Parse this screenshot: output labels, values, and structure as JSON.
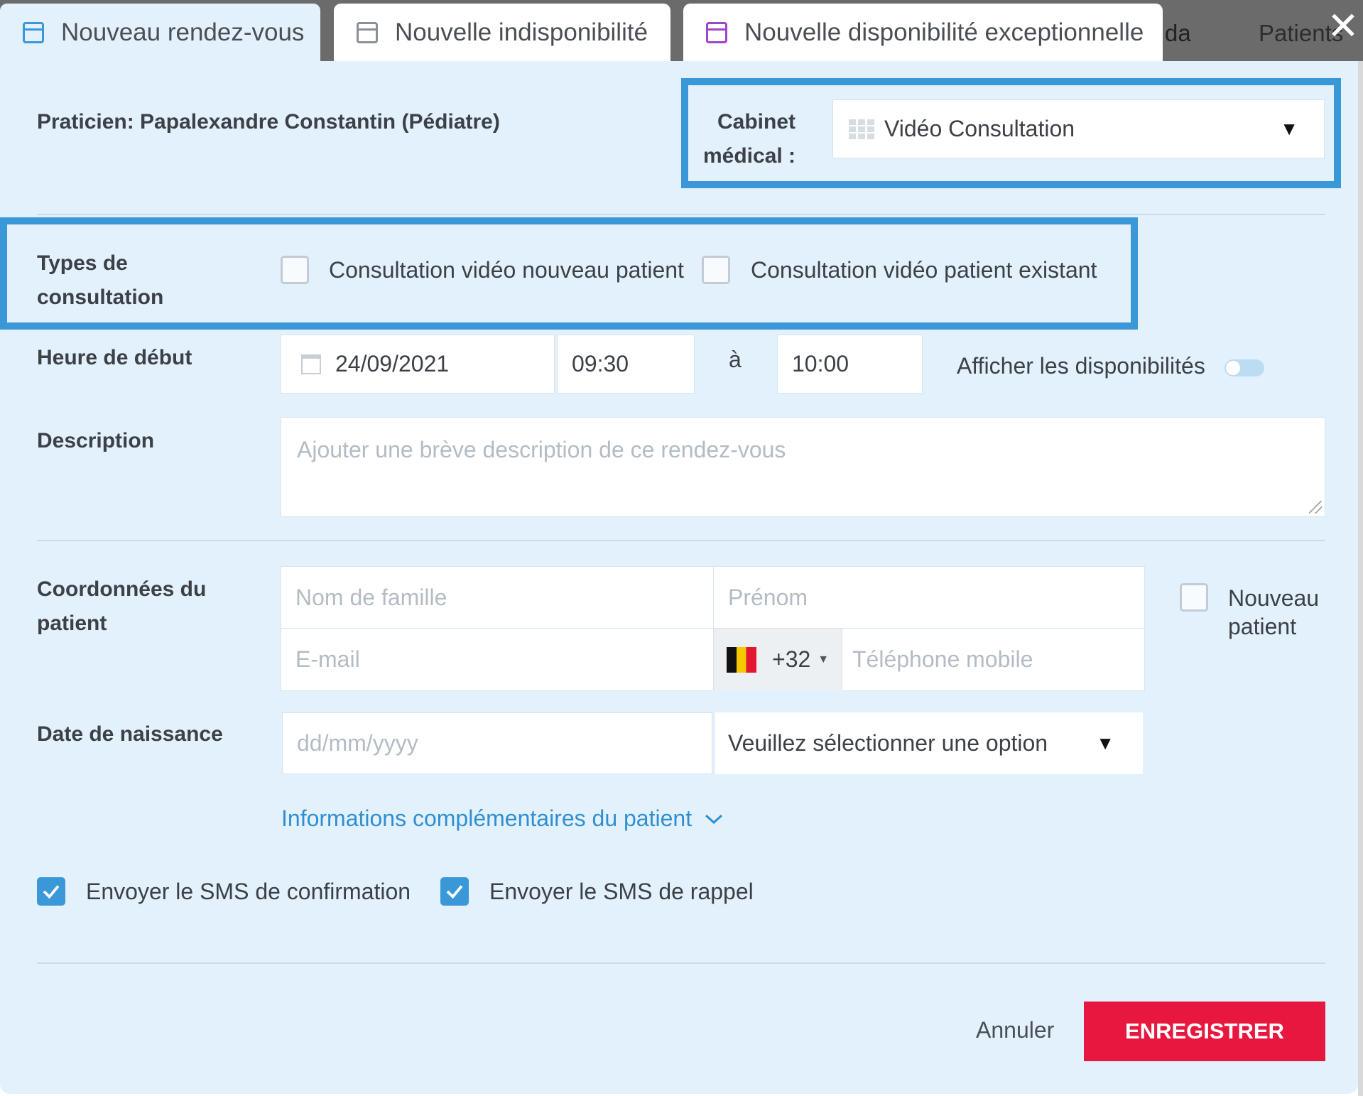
{
  "tabs": [
    {
      "label": "Nouveau rendez-vous",
      "icon": "calendar-plus-icon",
      "color": "#3a98d8"
    },
    {
      "label": "Nouvelle indisponibilité",
      "icon": "calendar-minus-icon",
      "color": "#8a9099"
    },
    {
      "label": "Nouvelle disponibilité exceptionnelle",
      "icon": "calendar-icon",
      "color": "#a044c9"
    }
  ],
  "background_tabs": [
    "da",
    "Patients"
  ],
  "close_label": "✕",
  "practitioner": "Praticien: Papalexandre Constantin (Pédiatre)",
  "cabinet": {
    "label_line1": "Cabinet",
    "label_line2": "médical :",
    "value": "Vidéo Consultation",
    "arrow": "▼"
  },
  "consultation_types": {
    "label_line1": "Types de",
    "label_line2": "consultation",
    "options": [
      "Consultation vidéo nouveau patient",
      "Consultation vidéo patient existant"
    ]
  },
  "start_time": {
    "label": "Heure de début",
    "date": "24/09/2021",
    "from": "09:30",
    "separator": "à",
    "to": "10:00",
    "availability_label": "Afficher les disponibilités"
  },
  "description": {
    "label": "Description",
    "placeholder": "Ajouter une brève description de ce rendez-vous"
  },
  "patient": {
    "label_line1": "Coordonnées du",
    "label_line2": "patient",
    "last_name_placeholder": "Nom de famille",
    "first_name_placeholder": "Prénom",
    "email_placeholder": "E-mail",
    "phone_prefix": "+32",
    "phone_placeholder": "Téléphone mobile",
    "new_patient_line1": "Nouveau",
    "new_patient_line2": "patient"
  },
  "birth": {
    "label": "Date de naissance",
    "placeholder": "dd/mm/yyyy",
    "select_value": "Veuillez sélectionner une option",
    "arrow": "▼"
  },
  "more_info": "Informations complémentaires du patient",
  "sms": {
    "confirmation": "Envoyer le SMS de confirmation",
    "reminder": "Envoyer le SMS de rappel"
  },
  "actions": {
    "cancel": "Annuler",
    "save": "ENREGISTRER"
  },
  "colors": {
    "accent": "#3a98d8",
    "save": "#e8173f",
    "dialog_bg": "#e3f1fc"
  }
}
